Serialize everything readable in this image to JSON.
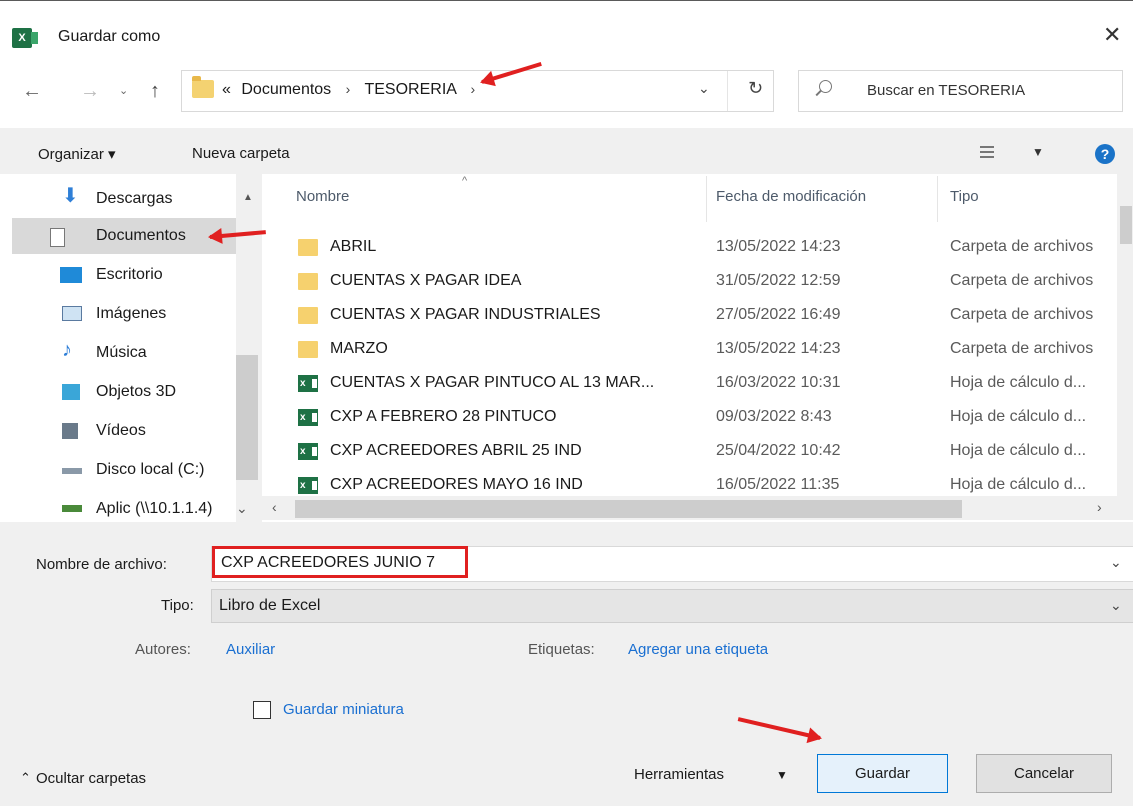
{
  "window": {
    "title": "Guardar como",
    "app_icon": "excel-icon"
  },
  "address": {
    "overflow": "«",
    "crumbs": [
      "Documentos",
      "TESORERIA"
    ],
    "search_placeholder": "Buscar en TESORERIA"
  },
  "toolbar": {
    "organize": "Organizar ▾",
    "new_folder": "Nueva carpeta"
  },
  "nav": [
    {
      "label": "Descargas",
      "icon": "download-arrow-icon"
    },
    {
      "label": "Documentos",
      "icon": "documents-icon",
      "selected": true
    },
    {
      "label": "Escritorio",
      "icon": "desktop-icon"
    },
    {
      "label": "Imágenes",
      "icon": "pictures-icon"
    },
    {
      "label": "Música",
      "icon": "music-icon"
    },
    {
      "label": "Objetos 3D",
      "icon": "3d-objects-icon"
    },
    {
      "label": "Vídeos",
      "icon": "videos-icon"
    },
    {
      "label": "Disco local (C:)",
      "icon": "drive-icon"
    },
    {
      "label": "Aplic (\\\\10.1.1.4)",
      "icon": "network-drive-icon"
    }
  ],
  "columns": {
    "name": "Nombre",
    "date": "Fecha de modificación",
    "type": "Tipo"
  },
  "files": [
    {
      "name": "ABRIL",
      "date": "13/05/2022 14:23",
      "type": "Carpeta de archivos",
      "kind": "folder"
    },
    {
      "name": "CUENTAS X PAGAR IDEA",
      "date": "31/05/2022 12:59",
      "type": "Carpeta de archivos",
      "kind": "folder"
    },
    {
      "name": "CUENTAS X PAGAR INDUSTRIALES",
      "date": "27/05/2022 16:49",
      "type": "Carpeta de archivos",
      "kind": "folder"
    },
    {
      "name": "MARZO",
      "date": "13/05/2022 14:23",
      "type": "Carpeta de archivos",
      "kind": "folder"
    },
    {
      "name": "CUENTAS X PAGAR PINTUCO AL 13 MAR...",
      "date": "16/03/2022 10:31",
      "type": "Hoja de cálculo d...",
      "kind": "excel"
    },
    {
      "name": "CXP A FEBRERO 28 PINTUCO",
      "date": "09/03/2022 8:43",
      "type": "Hoja de cálculo d...",
      "kind": "excel"
    },
    {
      "name": "CXP ACREEDORES ABRIL 25 IND",
      "date": "25/04/2022 10:42",
      "type": "Hoja de cálculo d...",
      "kind": "excel"
    },
    {
      "name": "CXP ACREEDORES MAYO 16 IND",
      "date": "16/05/2022 11:35",
      "type": "Hoja de cálculo d...",
      "kind": "excel"
    }
  ],
  "form": {
    "filename_label": "Nombre de archivo:",
    "filename_value": "CXP ACREEDORES JUNIO 7",
    "type_label": "Tipo:",
    "type_value": "Libro de Excel",
    "authors_label": "Autores:",
    "authors_value": "Auxiliar",
    "tags_label": "Etiquetas:",
    "tags_value": "Agregar una etiqueta",
    "thumbnail_label": "Guardar miniatura"
  },
  "footer": {
    "hide_folders": "Ocultar carpetas",
    "tools": "Herramientas",
    "save": "Guardar",
    "cancel": "Cancelar"
  },
  "colors": {
    "annotation": "#e02020",
    "link": "#1a6fd1",
    "excel_green": "#1e7145",
    "folder_yellow": "#f6d16e"
  }
}
